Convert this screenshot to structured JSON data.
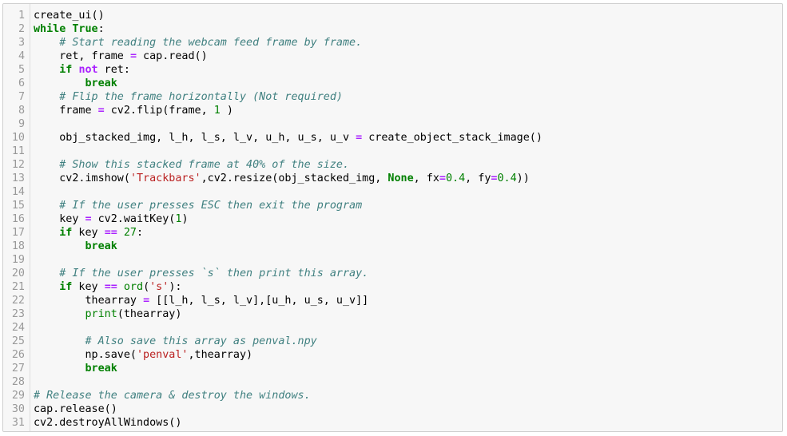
{
  "editor": {
    "lines": [
      {
        "n": "1",
        "tokens": [
          {
            "t": "create_ui()",
            "c": ""
          }
        ]
      },
      {
        "n": "2",
        "tokens": [
          {
            "t": "while",
            "c": "kw"
          },
          {
            "t": " ",
            "c": ""
          },
          {
            "t": "True",
            "c": "kw"
          },
          {
            "t": ":",
            "c": ""
          }
        ]
      },
      {
        "n": "3",
        "tokens": [
          {
            "t": "    ",
            "c": ""
          },
          {
            "t": "# Start reading the webcam feed frame by frame.",
            "c": "cm"
          }
        ]
      },
      {
        "n": "4",
        "tokens": [
          {
            "t": "    ret, frame ",
            "c": ""
          },
          {
            "t": "=",
            "c": "op"
          },
          {
            "t": " cap.read()",
            "c": ""
          }
        ]
      },
      {
        "n": "5",
        "tokens": [
          {
            "t": "    ",
            "c": ""
          },
          {
            "t": "if",
            "c": "kw"
          },
          {
            "t": " ",
            "c": ""
          },
          {
            "t": "not",
            "c": "op"
          },
          {
            "t": " ret:",
            "c": ""
          }
        ]
      },
      {
        "n": "6",
        "tokens": [
          {
            "t": "        ",
            "c": ""
          },
          {
            "t": "break",
            "c": "kw"
          }
        ]
      },
      {
        "n": "7",
        "tokens": [
          {
            "t": "    ",
            "c": ""
          },
          {
            "t": "# Flip the frame horizontally (Not required)",
            "c": "cm"
          }
        ]
      },
      {
        "n": "8",
        "tokens": [
          {
            "t": "    frame ",
            "c": ""
          },
          {
            "t": "=",
            "c": "op"
          },
          {
            "t": " cv2.flip(frame, ",
            "c": ""
          },
          {
            "t": "1",
            "c": "nm"
          },
          {
            "t": " )",
            "c": ""
          }
        ]
      },
      {
        "n": "9",
        "tokens": []
      },
      {
        "n": "10",
        "tokens": [
          {
            "t": "    obj_stacked_img, l_h, l_s, l_v, u_h, u_s, u_v ",
            "c": ""
          },
          {
            "t": "=",
            "c": "op"
          },
          {
            "t": " create_object_stack_image()",
            "c": ""
          }
        ]
      },
      {
        "n": "11",
        "tokens": []
      },
      {
        "n": "12",
        "tokens": [
          {
            "t": "    ",
            "c": ""
          },
          {
            "t": "# Show this stacked frame at 40% of the size.",
            "c": "cm"
          }
        ]
      },
      {
        "n": "13",
        "tokens": [
          {
            "t": "    cv2.imshow(",
            "c": ""
          },
          {
            "t": "'Trackbars'",
            "c": "st"
          },
          {
            "t": ",cv2.resize(obj_stacked_img, ",
            "c": ""
          },
          {
            "t": "None",
            "c": "kw"
          },
          {
            "t": ", fx",
            "c": ""
          },
          {
            "t": "=",
            "c": "op"
          },
          {
            "t": "0.4",
            "c": "nm"
          },
          {
            "t": ", fy",
            "c": ""
          },
          {
            "t": "=",
            "c": "op"
          },
          {
            "t": "0.4",
            "c": "nm"
          },
          {
            "t": "))",
            "c": ""
          }
        ]
      },
      {
        "n": "14",
        "tokens": []
      },
      {
        "n": "15",
        "tokens": [
          {
            "t": "    ",
            "c": ""
          },
          {
            "t": "# If the user presses ESC then exit the program",
            "c": "cm"
          }
        ]
      },
      {
        "n": "16",
        "tokens": [
          {
            "t": "    key ",
            "c": ""
          },
          {
            "t": "=",
            "c": "op"
          },
          {
            "t": " cv2.waitKey(",
            "c": ""
          },
          {
            "t": "1",
            "c": "nm"
          },
          {
            "t": ")",
            "c": ""
          }
        ]
      },
      {
        "n": "17",
        "tokens": [
          {
            "t": "    ",
            "c": ""
          },
          {
            "t": "if",
            "c": "kw"
          },
          {
            "t": " key ",
            "c": ""
          },
          {
            "t": "==",
            "c": "op"
          },
          {
            "t": " ",
            "c": ""
          },
          {
            "t": "27",
            "c": "nm"
          },
          {
            "t": ":",
            "c": ""
          }
        ]
      },
      {
        "n": "18",
        "tokens": [
          {
            "t": "        ",
            "c": ""
          },
          {
            "t": "break",
            "c": "kw"
          }
        ]
      },
      {
        "n": "19",
        "tokens": []
      },
      {
        "n": "20",
        "tokens": [
          {
            "t": "    ",
            "c": ""
          },
          {
            "t": "# If the user presses `s` then print this array.",
            "c": "cm"
          }
        ]
      },
      {
        "n": "21",
        "tokens": [
          {
            "t": "    ",
            "c": ""
          },
          {
            "t": "if",
            "c": "kw"
          },
          {
            "t": " key ",
            "c": ""
          },
          {
            "t": "==",
            "c": "op"
          },
          {
            "t": " ",
            "c": ""
          },
          {
            "t": "ord",
            "c": "bi"
          },
          {
            "t": "(",
            "c": ""
          },
          {
            "t": "'s'",
            "c": "st"
          },
          {
            "t": "):",
            "c": ""
          }
        ]
      },
      {
        "n": "22",
        "tokens": [
          {
            "t": "        thearray ",
            "c": ""
          },
          {
            "t": "=",
            "c": "op"
          },
          {
            "t": " [[l_h, l_s, l_v],[u_h, u_s, u_v]]",
            "c": ""
          }
        ]
      },
      {
        "n": "23",
        "tokens": [
          {
            "t": "        ",
            "c": ""
          },
          {
            "t": "print",
            "c": "bi"
          },
          {
            "t": "(thearray)",
            "c": ""
          }
        ]
      },
      {
        "n": "24",
        "tokens": []
      },
      {
        "n": "25",
        "tokens": [
          {
            "t": "        ",
            "c": ""
          },
          {
            "t": "# Also save this array as penval.npy",
            "c": "cm"
          }
        ]
      },
      {
        "n": "26",
        "tokens": [
          {
            "t": "        np.save(",
            "c": ""
          },
          {
            "t": "'penval'",
            "c": "st"
          },
          {
            "t": ",thearray)",
            "c": ""
          }
        ]
      },
      {
        "n": "27",
        "tokens": [
          {
            "t": "        ",
            "c": ""
          },
          {
            "t": "break",
            "c": "kw"
          }
        ]
      },
      {
        "n": "28",
        "tokens": []
      },
      {
        "n": "29",
        "tokens": [
          {
            "t": "# Release the camera & destroy the windows.",
            "c": "cm"
          }
        ]
      },
      {
        "n": "30",
        "tokens": [
          {
            "t": "cap.release()",
            "c": ""
          }
        ]
      },
      {
        "n": "31",
        "tokens": [
          {
            "t": "cv2.destroyAllWindows()",
            "c": ""
          }
        ]
      }
    ]
  },
  "colors": {
    "keyword": "#008000",
    "comment": "#408080",
    "operator": "#aa22ff",
    "string": "#ba2121",
    "number": "#008000",
    "line_number": "#999999",
    "background": "#f7f7f7"
  }
}
